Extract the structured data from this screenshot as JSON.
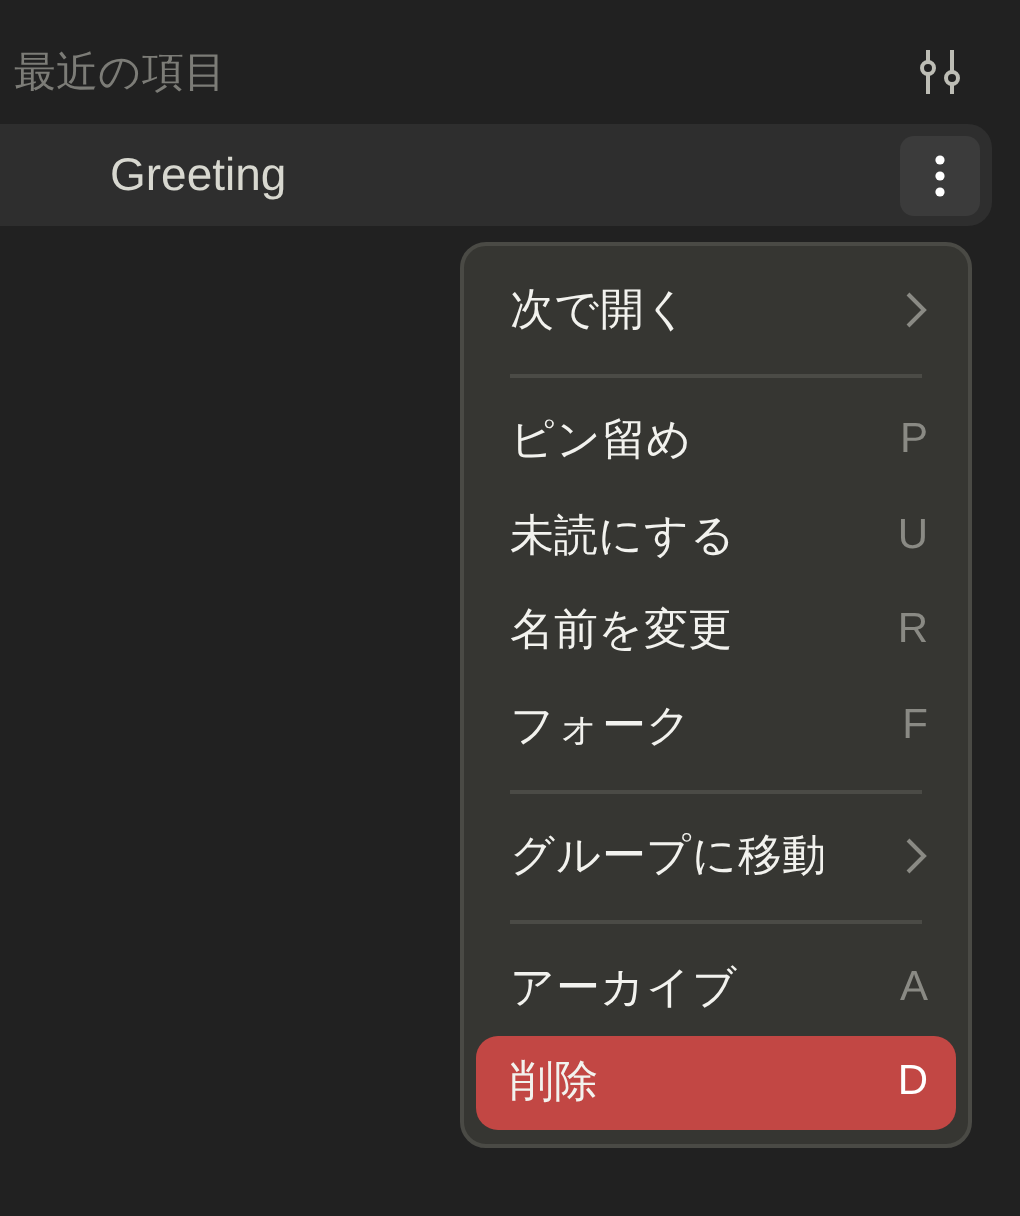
{
  "header": {
    "title": "最近の項目"
  },
  "item": {
    "title": "Greeting"
  },
  "menu": {
    "sections": [
      [
        {
          "label": "次で開く",
          "kind": "submenu",
          "selected": false
        }
      ],
      [
        {
          "label": "ピン留め",
          "kind": "shortcut",
          "shortcut": "P",
          "selected": false
        },
        {
          "label": "未読にする",
          "kind": "shortcut",
          "shortcut": "U",
          "selected": false
        },
        {
          "label": "名前を変更",
          "kind": "shortcut",
          "shortcut": "R",
          "selected": false
        },
        {
          "label": "フォーク",
          "kind": "shortcut",
          "shortcut": "F",
          "selected": false
        }
      ],
      [
        {
          "label": "グループに移動",
          "kind": "submenu",
          "selected": false
        }
      ],
      [
        {
          "label": "アーカイブ",
          "kind": "shortcut",
          "shortcut": "A",
          "selected": false
        },
        {
          "label": "削除",
          "kind": "shortcut",
          "shortcut": "D",
          "selected": true
        }
      ]
    ]
  }
}
